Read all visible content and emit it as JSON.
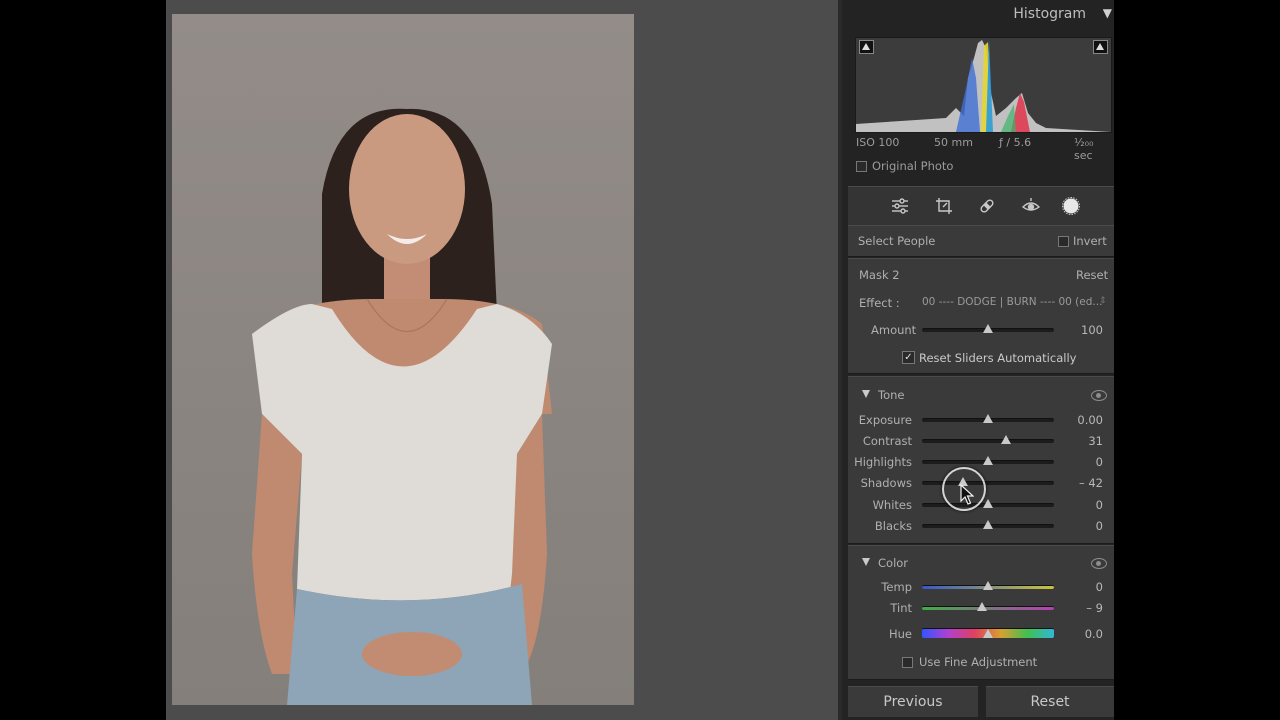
{
  "histogram": {
    "title": "Histogram",
    "exif": {
      "iso": "ISO 100",
      "focal": "50 mm",
      "aperture": "ƒ / 5.6",
      "shutter": "¹⁄₂₀₀ sec"
    },
    "original_photo_label": "Original Photo"
  },
  "tools": [
    "sliders-icon",
    "crop-icon",
    "healing-icon",
    "redeye-icon",
    "mask-icon"
  ],
  "select_people": {
    "label": "Select People",
    "invert_label": "Invert"
  },
  "mask": {
    "name": "Mask 2",
    "reset_label": "Reset",
    "effect_label": "Effect :",
    "effect_value": "00 ---- DODGE | BURN ---- 00 (ed...",
    "amount_label": "Amount",
    "amount_value": "100",
    "amount_pos": 0.5,
    "reset_sliders_label": "Reset Sliders Automatically"
  },
  "tone": {
    "title": "Tone",
    "sliders": [
      {
        "label": "Exposure",
        "value": "0.00",
        "pos": 0.5
      },
      {
        "label": "Contrast",
        "value": "31",
        "pos": 0.655
      },
      {
        "label": "Highlights",
        "value": "0",
        "pos": 0.5
      },
      {
        "label": "Shadows",
        "value": "– 42",
        "pos": 0.29
      },
      {
        "label": "Whites",
        "value": "0",
        "pos": 0.5
      },
      {
        "label": "Blacks",
        "value": "0",
        "pos": 0.5
      }
    ]
  },
  "color": {
    "title": "Color",
    "sliders": [
      {
        "label": "Temp",
        "value": "0",
        "pos": 0.5
      },
      {
        "label": "Tint",
        "value": "– 9",
        "pos": 0.455
      },
      {
        "label": "Hue",
        "value": "0.0",
        "pos": 0.5
      }
    ],
    "fine_adjust_label": "Use Fine Adjustment"
  },
  "footer": {
    "previous_label": "Previous",
    "reset_label": "Reset"
  },
  "colors": {
    "panel_bg": "#232323",
    "section_bg": "#3a3a3a",
    "stage_bg": "#4c4c4c"
  }
}
